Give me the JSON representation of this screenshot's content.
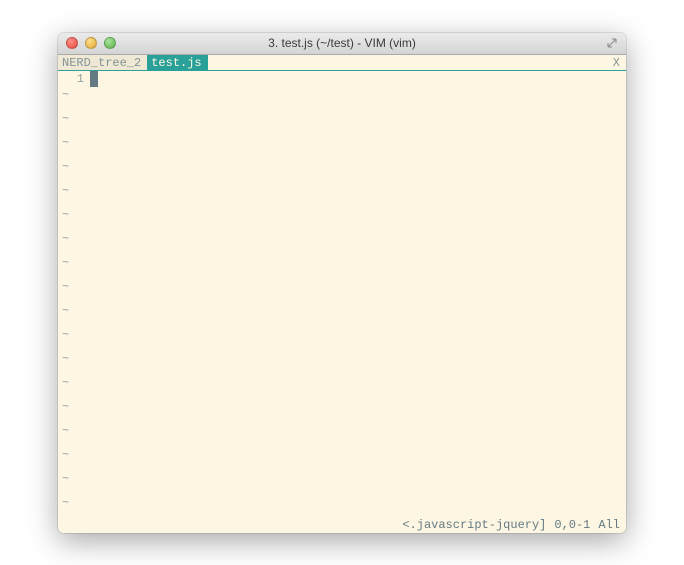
{
  "titlebar": {
    "title": "3. test.js (~/test) - VIM (vim)"
  },
  "tabs": {
    "inactive": "NERD_tree_2",
    "active": "test.js",
    "close": "X"
  },
  "editor": {
    "line_number": "1",
    "tilde": "~",
    "tilde_count": 18
  },
  "status": {
    "filetype": "<.javascript-jquery]",
    "position": "0,0-1",
    "scroll": "All"
  }
}
